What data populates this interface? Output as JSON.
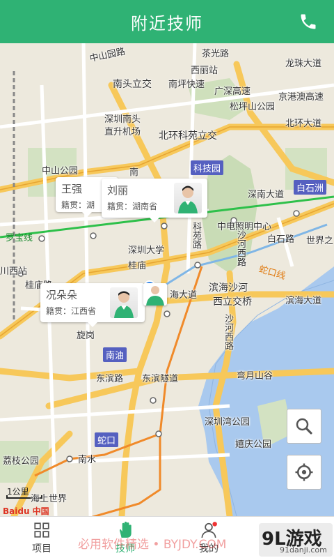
{
  "header": {
    "title": "附近技师",
    "phone_icon": "phone-icon"
  },
  "map": {
    "labels": [
      {
        "id": "l1",
        "text": "中山园路"
      },
      {
        "id": "l2",
        "text": "茶光路"
      },
      {
        "id": "l3",
        "text": "龙珠大道"
      },
      {
        "id": "l4",
        "text": "西丽站"
      },
      {
        "id": "l5",
        "text": "南头立交"
      },
      {
        "id": "l6",
        "text": "南坪快速"
      },
      {
        "id": "l7",
        "text": "广深高速"
      },
      {
        "id": "l8",
        "text": "京港澳高速"
      },
      {
        "id": "l9",
        "text": "松坪山公园"
      },
      {
        "id": "l10",
        "text": "深圳南头"
      },
      {
        "id": "l11",
        "text": "直升机场"
      },
      {
        "id": "l12",
        "text": "北环科苑立交"
      },
      {
        "id": "l13",
        "text": "北环大道"
      },
      {
        "id": "l14",
        "text": "中山公园"
      },
      {
        "id": "l15",
        "text": "南"
      },
      {
        "id": "l16",
        "text": "深南大道"
      },
      {
        "id": "l17",
        "text": "中电照明中心"
      },
      {
        "id": "l18",
        "text": "白石路"
      },
      {
        "id": "l19",
        "text": "世界之"
      },
      {
        "id": "l20",
        "text": "罗宝线"
      },
      {
        "id": "l21",
        "text": "深圳大学"
      },
      {
        "id": "l22",
        "text": "桂庙"
      },
      {
        "id": "l23",
        "text": "科苑路"
      },
      {
        "id": "l24",
        "text": "沙河西路"
      },
      {
        "id": "l25",
        "text": "蛇口线"
      },
      {
        "id": "l26",
        "text": "川西站"
      },
      {
        "id": "l27",
        "text": "桂庙路"
      },
      {
        "id": "l28",
        "text": "滨海沙河"
      },
      {
        "id": "l29",
        "text": "西立交桥"
      },
      {
        "id": "l30",
        "text": "海大道"
      },
      {
        "id": "l31",
        "text": "滨海大道"
      },
      {
        "id": "l32",
        "text": "旋岗"
      },
      {
        "id": "l33",
        "text": "东滨路"
      },
      {
        "id": "l34",
        "text": "东滨隧道"
      },
      {
        "id": "l35",
        "text": "弯月山谷"
      },
      {
        "id": "l36",
        "text": "深圳湾公园"
      },
      {
        "id": "l37",
        "text": "嬉庆公园"
      },
      {
        "id": "l38",
        "text": "荔枝公园"
      },
      {
        "id": "l39",
        "text": "南水"
      },
      {
        "id": "l40",
        "text": "海上世界"
      },
      {
        "id": "l41",
        "text": "沙河西路"
      }
    ],
    "tags": [
      {
        "id": "t1",
        "text": "科技园"
      },
      {
        "id": "t2",
        "text": "白石洲"
      },
      {
        "id": "t3",
        "text": "南油"
      },
      {
        "id": "t4",
        "text": "蛇口"
      }
    ],
    "scale": "1公里",
    "attribution": "Baidu 中国"
  },
  "bubbles": [
    {
      "name": "王强",
      "origin": "籍贯：湖"
    },
    {
      "name": "刘丽",
      "origin": "籍贯：湖南省"
    },
    {
      "name": "况朵朵",
      "origin": "籍贯：江西省"
    }
  ],
  "map_controls": {
    "search_icon": "search-icon",
    "locate_icon": "locate-icon"
  },
  "bottom_nav": [
    {
      "label": "项目",
      "icon": "grid-icon"
    },
    {
      "label": "技师",
      "icon": "hand-icon",
      "active": true
    },
    {
      "label": "我的",
      "icon": "user-icon"
    }
  ],
  "watermark": {
    "text": "必用软件精选 • BYJDY.COM",
    "logo": "9L游戏",
    "logo_sub": "91danji.com"
  },
  "colors": {
    "primary": "#2fb274",
    "map_bg": "#ede9dd"
  }
}
